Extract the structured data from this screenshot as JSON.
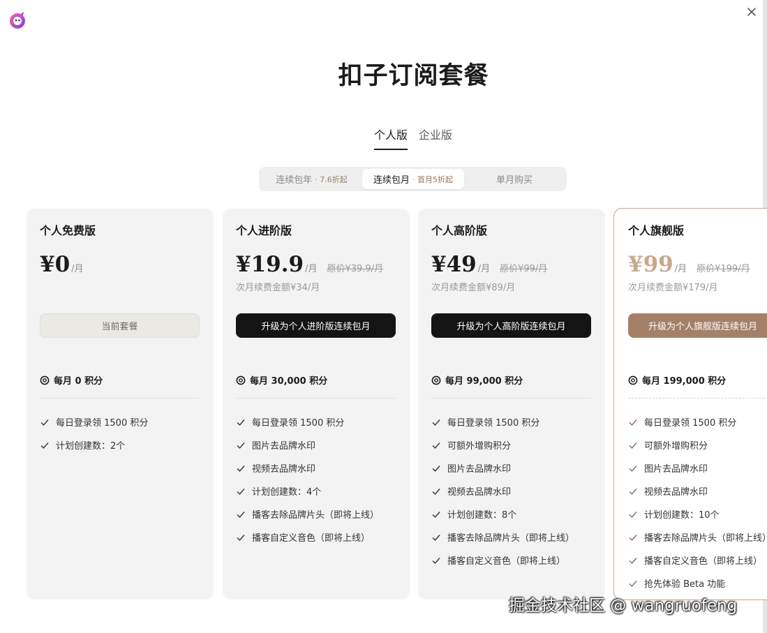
{
  "page": {
    "title": "扣子订阅套餐",
    "tabs": [
      {
        "label": "个人版",
        "active": true
      },
      {
        "label": "企业版",
        "active": false
      }
    ],
    "billing": [
      {
        "label": "连续包年",
        "discount": "· 7.6折起",
        "active": false
      },
      {
        "label": "连续包月",
        "discount": "· 首月5折起",
        "active": true
      },
      {
        "label": "单月购买",
        "discount": "",
        "active": false
      }
    ],
    "watermark": "掘金技术社区 @ wangruofeng"
  },
  "colors": {
    "accent_brown": "#a48069",
    "flagship_price": "#c8a78a",
    "dark_button": "#141414"
  },
  "plans": [
    {
      "name": "个人免费版",
      "price": "¥0",
      "per": "/月",
      "original": "",
      "renew": "",
      "button": "当前套餐",
      "points": "每月 0 积分",
      "features": [
        "每日登录领 1500 积分",
        "计划创建数：2个"
      ]
    },
    {
      "name": "个人进阶版",
      "price": "¥19.9",
      "per": "/月",
      "original": "原价¥39.9/月",
      "renew": "次月续费金额¥34/月",
      "button": "升级为个人进阶版连续包月",
      "points": "每月 30,000 积分",
      "features": [
        "每日登录领 1500 积分",
        "图片去品牌水印",
        "视频去品牌水印",
        "计划创建数：4个",
        "播客去除品牌片头（即将上线）",
        "播客自定义音色（即将上线）"
      ]
    },
    {
      "name": "个人高阶版",
      "price": "¥49",
      "per": "/月",
      "original": "原价¥99/月",
      "renew": "次月续费金额¥89/月",
      "button": "升级为个人高阶版连续包月",
      "points": "每月 99,000 积分",
      "features": [
        "每日登录领 1500 积分",
        "可额外增购积分",
        "图片去品牌水印",
        "视频去品牌水印",
        "计划创建数：8个",
        "播客去除品牌片头（即将上线）",
        "播客自定义音色（即将上线）"
      ]
    },
    {
      "name": "个人旗舰版",
      "price": "¥99",
      "per": "/月",
      "original": "原价¥199/月",
      "renew": "次月续费金额¥179/月",
      "button": "升级为个人旗舰版连续包月",
      "points": "每月 199,000 积分",
      "features": [
        "每日登录领 1500 积分",
        "可额外增购积分",
        "图片去品牌水印",
        "视频去品牌水印",
        "计划创建数：10个",
        "播客去除品牌片头（即将上线）",
        "播客自定义音色（即将上线）",
        "抢先体验 Beta 功能"
      ]
    }
  ]
}
